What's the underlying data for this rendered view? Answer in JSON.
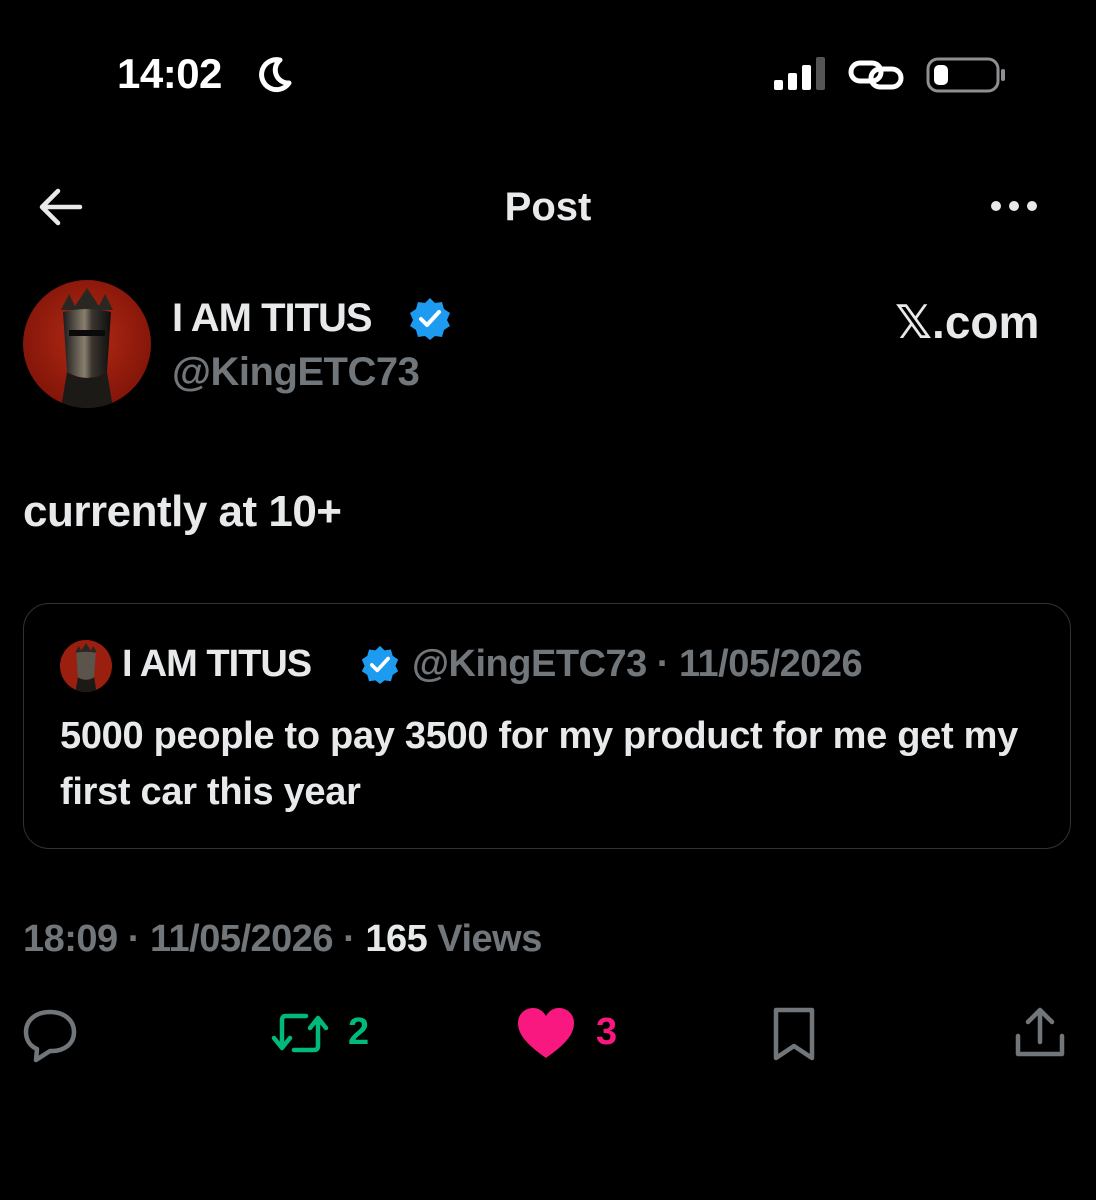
{
  "status_bar": {
    "time": "14:02",
    "icons": [
      "moon-icon",
      "cellular-signal-icon",
      "link-icon",
      "battery-icon"
    ]
  },
  "header": {
    "title": "Post",
    "back_icon": "back-arrow-icon",
    "more_icon": "more-options-icon"
  },
  "post": {
    "author_name": "I AM TITUS",
    "author_handle": "@KingETC73",
    "watermark": "𝕏.com",
    "text": "currently at 10+",
    "quoted": {
      "author_name": "I AM TITUS",
      "meta": "@KingETC73 · 11/05/2026",
      "text": "5000 people to pay 3500 for my product for me get my first car this year"
    },
    "timestamp": "18:09 · 11/05/2026 · ",
    "views_count": "165",
    "views_label": " Views",
    "retweets": "2",
    "likes": "3"
  },
  "colors": {
    "background": "#000000",
    "text_primary": "#e7e9ea",
    "text_secondary": "#71767b",
    "verified_blue": "#1d9bf0",
    "retweet_green": "#00ba7c",
    "like_pink": "#f91880",
    "border": "#2f3336"
  }
}
